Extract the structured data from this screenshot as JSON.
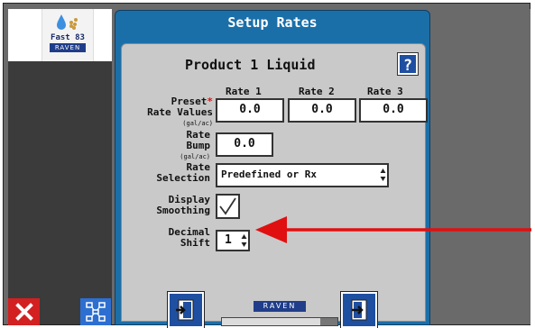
{
  "logo": {
    "title": "Fast 83",
    "brand": "RAVEN"
  },
  "dialog": {
    "title": "Setup Rates",
    "product_title": "Product 1 Liquid",
    "help_label": "?"
  },
  "columns": [
    "Rate 1",
    "Rate 2",
    "Rate 3"
  ],
  "preset": {
    "label_line1": "Preset",
    "label_line2": "Rate Values",
    "unit": "(gal/ac)",
    "required_mark": "*",
    "values": [
      "0.0",
      "0.0",
      "0.0"
    ]
  },
  "rate_bump": {
    "label_line1": "Rate",
    "label_line2": "Bump",
    "unit": "(gal/ac)",
    "value": "0.0"
  },
  "rate_selection": {
    "label_line1": "Rate",
    "label_line2": "Selection",
    "value": "Predefined or Rx"
  },
  "display_smoothing": {
    "label_line1": "Display",
    "label_line2": "Smoothing",
    "checked": true
  },
  "decimal_shift": {
    "label_line1": "Decimal",
    "label_line2": "Shift",
    "value": "1"
  },
  "footer": {
    "brand": "RAVEN",
    "progress": 0.85,
    "back_icon": "exit-left-icon",
    "next_icon": "enter-right-icon"
  },
  "side_buttons": {
    "cancel_icon": "close-icon",
    "network_icon": "network-icon"
  },
  "colors": {
    "dialog": "#1b6fa8",
    "panel": "#c9c9c9",
    "arrow": "#e01010",
    "cancel": "#d32020"
  }
}
